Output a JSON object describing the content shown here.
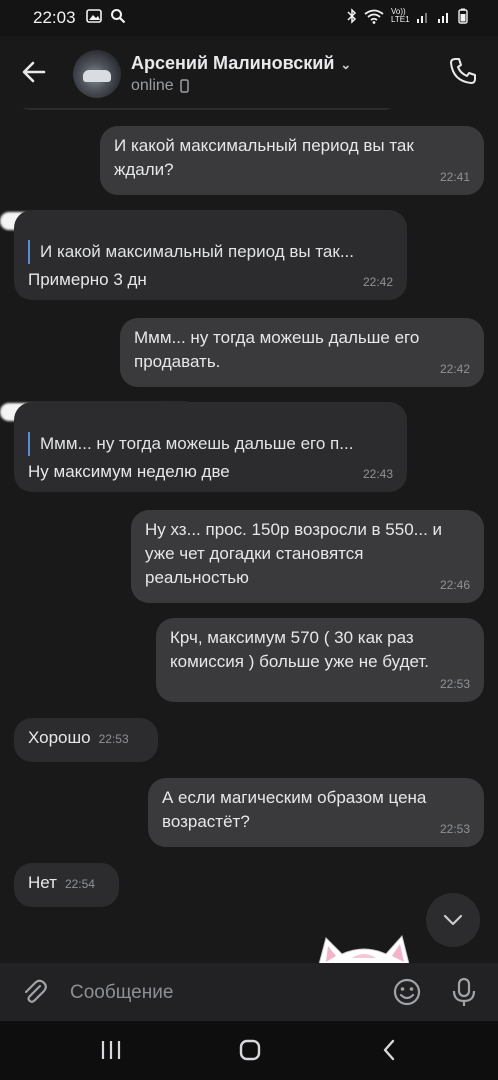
{
  "status_bar": {
    "time": "22:03",
    "network_label": "Vo)) LTE1"
  },
  "header": {
    "contact_name": "Арсений Малиновский",
    "status": "online"
  },
  "messages": [
    {
      "direction": "out",
      "text": "И какой максимальный период вы так ждали?",
      "time": "22:41"
    },
    {
      "direction": "in",
      "reply_to": "И какой максимальный период вы так...",
      "text": "Примерно 3 дн",
      "time": "22:42"
    },
    {
      "direction": "out",
      "text": "Ммм... ну тогда  можешь дальше его продавать.",
      "time": "22:42"
    },
    {
      "direction": "in",
      "reply_to": "Ммм... ну тогда  можешь дальше его п...",
      "text": "Ну максимум неделю две",
      "time": "22:43"
    },
    {
      "direction": "out",
      "text": "Ну хз... прос. 150р возросли в 550... и уже чет догадки становятся реальностью",
      "time": "22:46"
    },
    {
      "direction": "out",
      "text": "Крч, максимум 570 ( 30 как раз комиссия ) больше уже не будет.",
      "time": "22:53"
    },
    {
      "direction": "in",
      "text": "Хорошо",
      "time": "22:53"
    },
    {
      "direction": "out",
      "text": "А если магическим образом цена возрастёт?",
      "time": "22:53"
    },
    {
      "direction": "in",
      "text": "Нет",
      "time": "22:54"
    }
  ],
  "composer": {
    "placeholder": "Сообщение"
  }
}
